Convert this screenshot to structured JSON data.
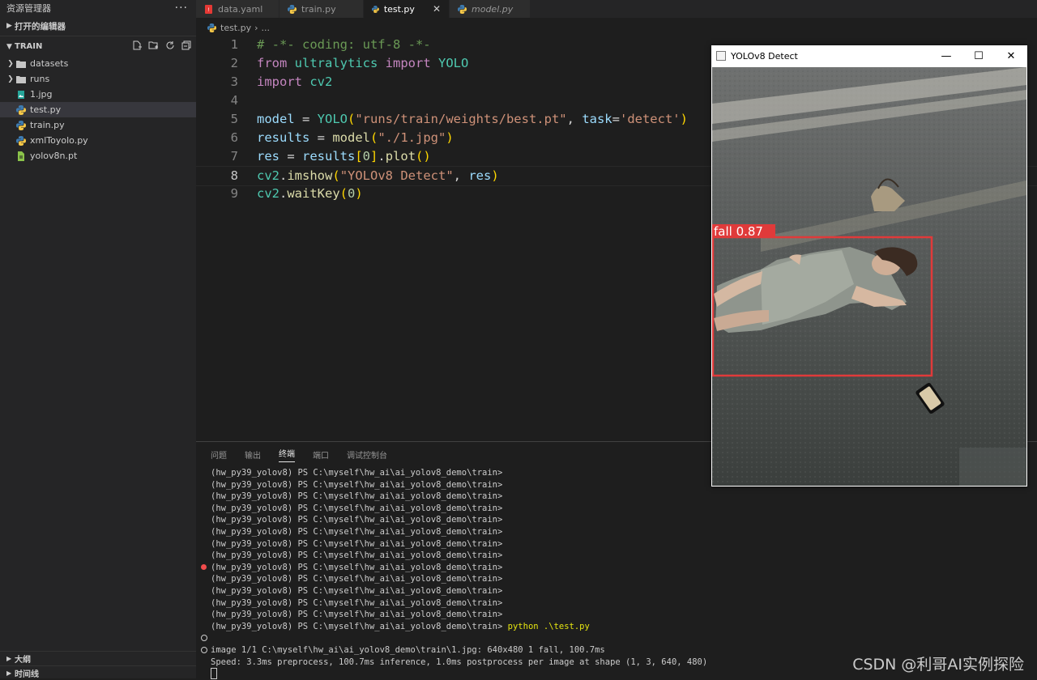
{
  "sidebar": {
    "title": "资源管理器",
    "more": "···",
    "open_editors": "打开的编辑器",
    "folder": "TRAIN",
    "items": [
      {
        "label": "datasets",
        "kind": "folder"
      },
      {
        "label": "runs",
        "kind": "folder"
      },
      {
        "label": "1.jpg",
        "kind": "image"
      },
      {
        "label": "test.py",
        "kind": "python",
        "active": true
      },
      {
        "label": "train.py",
        "kind": "python"
      },
      {
        "label": "xmlToyolo.py",
        "kind": "python"
      },
      {
        "label": "yolov8n.pt",
        "kind": "file"
      }
    ],
    "outline": "大纲",
    "timeline": "时间线"
  },
  "tabs": [
    {
      "label": "data.yaml",
      "icon": "yaml-icon"
    },
    {
      "label": "train.py",
      "icon": "python-icon"
    },
    {
      "label": "test.py",
      "icon": "python-icon",
      "active": true,
      "close": "✕"
    },
    {
      "label": "model.py",
      "icon": "python-icon",
      "italic": true
    }
  ],
  "breadcrumb": {
    "file": "test.py",
    "sep": "›",
    "rest": "..."
  },
  "editor": {
    "line_numbers": [
      "1",
      "2",
      "3",
      "4",
      "5",
      "6",
      "7",
      "8",
      "9"
    ],
    "current_line": "8"
  },
  "panel": {
    "tabs": [
      "问题",
      "输出",
      "终端",
      "端口",
      "调试控制台"
    ],
    "active_tab": "终端",
    "prompt": "(hw_py39_yolov8) PS C:\\myself\\hw_ai\\ai_yolov8_demo\\train>",
    "command": "python .\\test.py",
    "output1": "image 1/1 C:\\myself\\hw_ai\\ai_yolov8_demo\\train\\1.jpg: 640x480 1 fall, 100.7ms",
    "output2": "Speed: 3.3ms preprocess, 100.7ms inference, 1.0ms postprocess per image at shape (1, 3, 640, 480)"
  },
  "window": {
    "title": "YOLOv8 Detect",
    "minimize": "—",
    "maximize": "☐",
    "close": "✕",
    "detection_label": "fall 0.87",
    "box_color": "#e03a3a"
  },
  "watermark": "CSDN @利哥AI实例探险"
}
